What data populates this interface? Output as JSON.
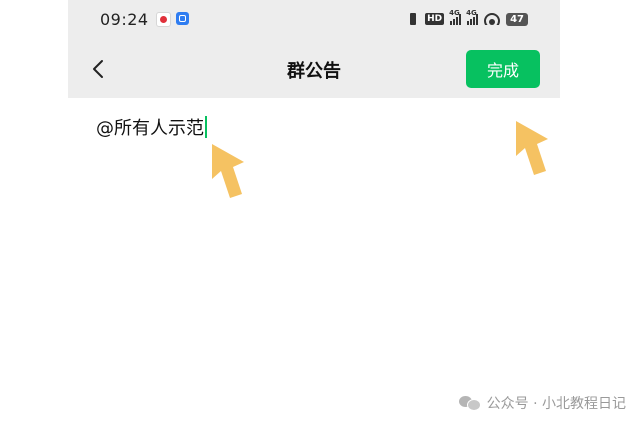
{
  "status_bar": {
    "time": "09:24",
    "hd_badge": "HD",
    "signal_1": "4G",
    "signal_2": "4G",
    "battery": "47"
  },
  "nav": {
    "title": "群公告",
    "done_label": "完成",
    "back_icon": "chevron-left-icon"
  },
  "editor": {
    "text": "@所有人示范"
  },
  "watermark": {
    "text": "公众号 · 小北教程日记"
  },
  "colors": {
    "accent": "#07c160",
    "nav_background": "#ededed",
    "annotation_arrow": "#f5c262"
  }
}
